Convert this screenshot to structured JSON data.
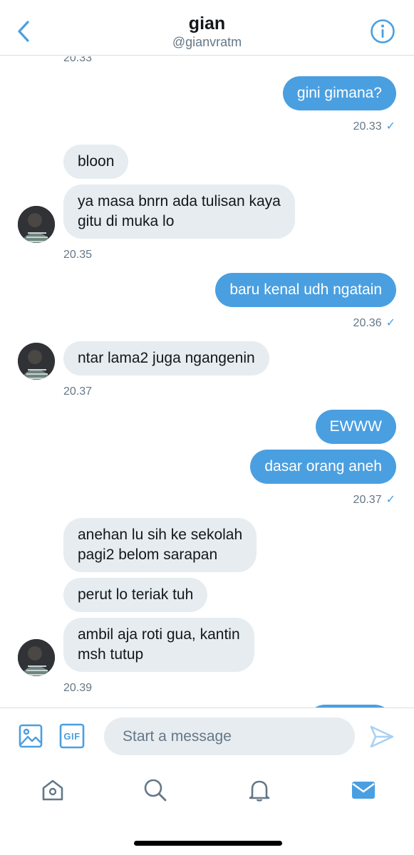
{
  "header": {
    "title": "gian",
    "handle": "@gianvratm"
  },
  "messages": {
    "ts0": "20.33",
    "m1": "gini gimana?",
    "ts1": "20.33",
    "m2": "bloon",
    "m3a": "ya masa bnrn ada tulisan kaya",
    "m3b": "gitu di muka lo",
    "ts2": "20.35",
    "m4": "baru kenal udh ngatain",
    "ts3": "20.36",
    "m5": "ntar lama2 juga ngangenin",
    "ts4": "20.37",
    "m6": "EWWW",
    "m7": "dasar orang aneh",
    "ts5": "20.37",
    "m8a": "anehan lu sih ke sekolah",
    "m8b": "pagi2 belom sarapan",
    "m9": "perut lo teriak tuh",
    "m10a": "ambil aja roti gua, kantin",
    "m10b": "msh tutup",
    "ts6": "20.39"
  },
  "composer": {
    "placeholder": "Start a message",
    "gif_label": "GIF"
  },
  "icons": {
    "back": "chevron-left-icon",
    "info": "info-icon",
    "image": "image-icon",
    "gif": "gif-icon",
    "send": "send-icon",
    "home": "home-icon",
    "search": "search-icon",
    "notifications": "bell-icon",
    "messages": "mail-icon"
  },
  "colors": {
    "accent": "#4a9fe0",
    "incoming_bubble": "#e6ecf0",
    "muted_text": "#657786"
  }
}
